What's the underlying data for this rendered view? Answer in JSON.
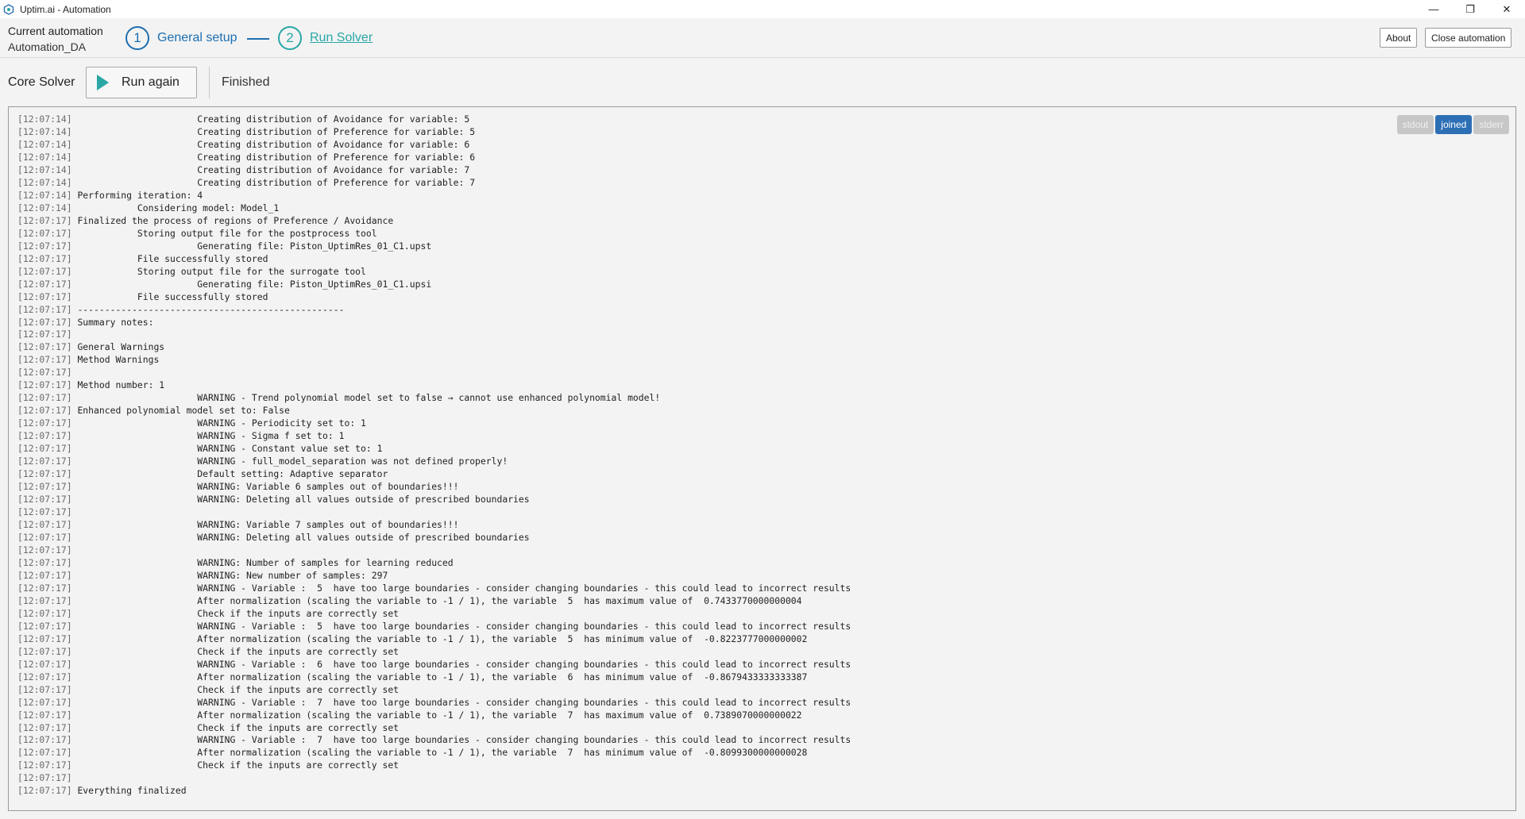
{
  "window": {
    "title": "Uptim.ai - Automation",
    "controls": {
      "minimize": "—",
      "restore": "❐",
      "close": "✕"
    }
  },
  "header": {
    "current_label": "Current automation",
    "current_value": "Automation_DA",
    "steps": [
      {
        "number": "1",
        "label": "General setup"
      },
      {
        "number": "2",
        "label": "Run Solver"
      }
    ],
    "about_label": "About",
    "close_label": "Close automation"
  },
  "toolbar": {
    "section_label": "Core Solver",
    "run_label": "Run again",
    "status": "Finished"
  },
  "console": {
    "tabs": [
      "stdout",
      "joined",
      "stderr"
    ],
    "active_tab": "joined",
    "lines": [
      {
        "ts": "[12:07:14]",
        "text": "                      Creating distribution of Avoidance for variable: 5"
      },
      {
        "ts": "[12:07:14]",
        "text": "                      Creating distribution of Preference for variable: 5"
      },
      {
        "ts": "[12:07:14]",
        "text": "                      Creating distribution of Avoidance for variable: 6"
      },
      {
        "ts": "[12:07:14]",
        "text": "                      Creating distribution of Preference for variable: 6"
      },
      {
        "ts": "[12:07:14]",
        "text": "                      Creating distribution of Avoidance for variable: 7"
      },
      {
        "ts": "[12:07:14]",
        "text": "                      Creating distribution of Preference for variable: 7"
      },
      {
        "ts": "[12:07:14]",
        "text": "Performing iteration: 4"
      },
      {
        "ts": "[12:07:14]",
        "text": "           Considering model: Model_1"
      },
      {
        "ts": "[12:07:17]",
        "text": "Finalized the process of regions of Preference / Avoidance"
      },
      {
        "ts": "[12:07:17]",
        "text": "           Storing output file for the postprocess tool"
      },
      {
        "ts": "[12:07:17]",
        "text": "                      Generating file: Piston_UptimRes_01_C1.upst"
      },
      {
        "ts": "[12:07:17]",
        "text": "           File successfully stored"
      },
      {
        "ts": "[12:07:17]",
        "text": "           Storing output file for the surrogate tool"
      },
      {
        "ts": "[12:07:17]",
        "text": "                      Generating file: Piston_UptimRes_01_C1.upsi"
      },
      {
        "ts": "[12:07:17]",
        "text": "           File successfully stored"
      },
      {
        "ts": "[12:07:17]",
        "text": "-------------------------------------------------"
      },
      {
        "ts": "[12:07:17]",
        "text": "Summary notes:"
      },
      {
        "ts": "[12:07:17]",
        "text": ""
      },
      {
        "ts": "[12:07:17]",
        "text": "General Warnings"
      },
      {
        "ts": "[12:07:17]",
        "text": "Method Warnings"
      },
      {
        "ts": "[12:07:17]",
        "text": ""
      },
      {
        "ts": "[12:07:17]",
        "text": "Method number: 1"
      },
      {
        "ts": "[12:07:17]",
        "text": "                      WARNING - Trend polynomial model set to false → cannot use enhanced polynomial model!"
      },
      {
        "ts": "[12:07:17]",
        "text": "Enhanced polynomial model set to: False"
      },
      {
        "ts": "[12:07:17]",
        "text": "                      WARNING - Periodicity set to: 1"
      },
      {
        "ts": "[12:07:17]",
        "text": "                      WARNING - Sigma f set to: 1"
      },
      {
        "ts": "[12:07:17]",
        "text": "                      WARNING - Constant value set to: 1"
      },
      {
        "ts": "[12:07:17]",
        "text": "                      WARNING - full_model_separation was not defined properly!"
      },
      {
        "ts": "[12:07:17]",
        "text": "                      Default setting: Adaptive separator"
      },
      {
        "ts": "[12:07:17]",
        "text": "                      WARNING: Variable 6 samples out of boundaries!!!"
      },
      {
        "ts": "[12:07:17]",
        "text": "                      WARNING: Deleting all values outside of prescribed boundaries"
      },
      {
        "ts": "[12:07:17]",
        "text": ""
      },
      {
        "ts": "[12:07:17]",
        "text": "                      WARNING: Variable 7 samples out of boundaries!!!"
      },
      {
        "ts": "[12:07:17]",
        "text": "                      WARNING: Deleting all values outside of prescribed boundaries"
      },
      {
        "ts": "[12:07:17]",
        "text": ""
      },
      {
        "ts": "[12:07:17]",
        "text": "                      WARNING: Number of samples for learning reduced"
      },
      {
        "ts": "[12:07:17]",
        "text": "                      WARNING: New number of samples: 297"
      },
      {
        "ts": "[12:07:17]",
        "text": "                      WARNING - Variable :  5  have too large boundaries - consider changing boundaries - this could lead to incorrect results"
      },
      {
        "ts": "[12:07:17]",
        "text": "                      After normalization (scaling the variable to -1 / 1), the variable  5  has maximum value of  0.7433770000000004"
      },
      {
        "ts": "[12:07:17]",
        "text": "                      Check if the inputs are correctly set"
      },
      {
        "ts": "[12:07:17]",
        "text": "                      WARNING - Variable :  5  have too large boundaries - consider changing boundaries - this could lead to incorrect results"
      },
      {
        "ts": "[12:07:17]",
        "text": "                      After normalization (scaling the variable to -1 / 1), the variable  5  has minimum value of  -0.8223777000000002"
      },
      {
        "ts": "[12:07:17]",
        "text": "                      Check if the inputs are correctly set"
      },
      {
        "ts": "[12:07:17]",
        "text": "                      WARNING - Variable :  6  have too large boundaries - consider changing boundaries - this could lead to incorrect results"
      },
      {
        "ts": "[12:07:17]",
        "text": "                      After normalization (scaling the variable to -1 / 1), the variable  6  has minimum value of  -0.8679433333333387"
      },
      {
        "ts": "[12:07:17]",
        "text": "                      Check if the inputs are correctly set"
      },
      {
        "ts": "[12:07:17]",
        "text": "                      WARNING - Variable :  7  have too large boundaries - consider changing boundaries - this could lead to incorrect results"
      },
      {
        "ts": "[12:07:17]",
        "text": "                      After normalization (scaling the variable to -1 / 1), the variable  7  has maximum value of  0.7389070000000022"
      },
      {
        "ts": "[12:07:17]",
        "text": "                      Check if the inputs are correctly set"
      },
      {
        "ts": "[12:07:17]",
        "text": "                      WARNING - Variable :  7  have too large boundaries - consider changing boundaries - this could lead to incorrect results"
      },
      {
        "ts": "[12:07:17]",
        "text": "                      After normalization (scaling the variable to -1 / 1), the variable  7  has minimum value of  -0.8099300000000028"
      },
      {
        "ts": "[12:07:17]",
        "text": "                      Check if the inputs are correctly set"
      },
      {
        "ts": "[12:07:17]",
        "text": ""
      },
      {
        "ts": "[12:07:17]",
        "text": "Everything finalized"
      }
    ]
  },
  "colors": {
    "accent_blue": "#1e6fb0",
    "accent_teal": "#2aa6a6",
    "active_tab": "#2d6fb5"
  }
}
